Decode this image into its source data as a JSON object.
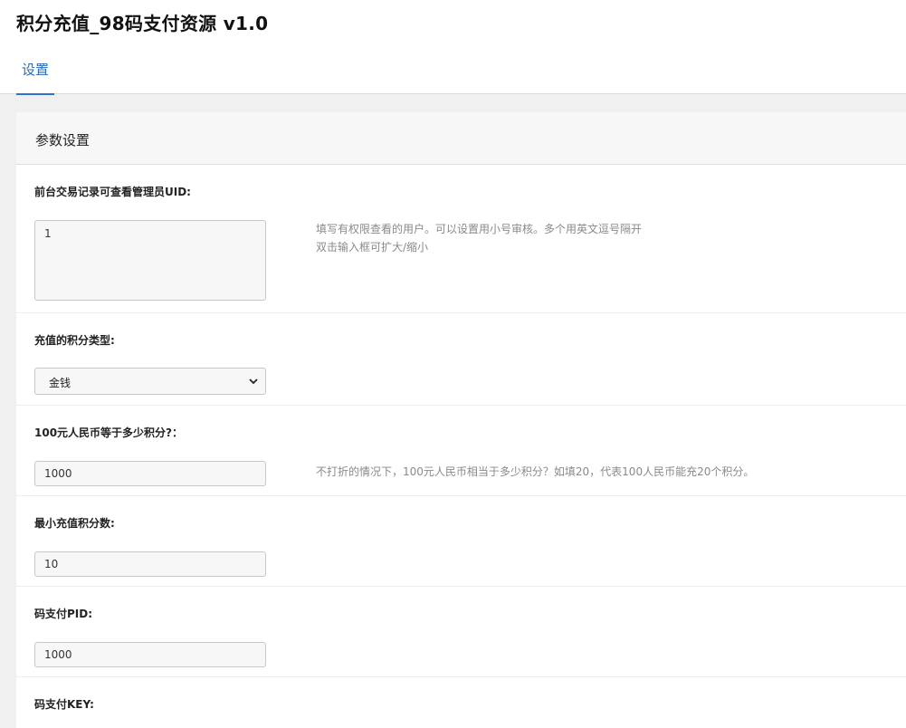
{
  "app": {
    "title": "积分充值_98码支付资源 v1.0"
  },
  "tabs": [
    {
      "label": "设置",
      "active": true
    }
  ],
  "panel": {
    "title": "参数设置"
  },
  "fields": [
    {
      "label": "前台交易记录可查看管理员UID:",
      "value": "1",
      "hint_lines": [
        "填写有权限查看的用户。可以设置用小号审核。多个用英文逗号隔开",
        "双击输入框可扩大/缩小"
      ]
    },
    {
      "label": "充值的积分类型:",
      "value": "金钱"
    },
    {
      "label": "100元人民币等于多少积分?：",
      "value": "1000",
      "hint_lines": [
        "不打折的情况下，100元人民币相当于多少积分？如填20，代表100人民币能充20个积分。"
      ]
    },
    {
      "label": "最小充值积分数:",
      "value": "10"
    },
    {
      "label": "码支付PID:",
      "value": "1000"
    },
    {
      "label": "码支付KEY:",
      "value": ""
    }
  ],
  "colors": {
    "accent": "#2f6fd0",
    "tab_text": "#2b6cb0",
    "hint": "#8a8a8a"
  },
  "icons": {
    "select_arrow": "chevron-down-icon"
  }
}
